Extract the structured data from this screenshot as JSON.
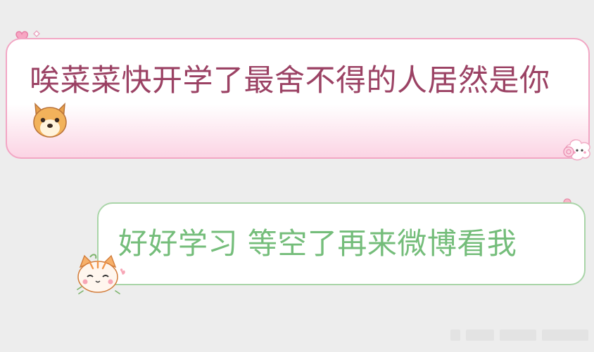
{
  "timestamp": "",
  "messages": [
    {
      "side": "left",
      "text": "唉菜菜快开学了最舍不得的人居然是你",
      "emoji": "dog-face-icon"
    },
    {
      "side": "right",
      "text": "好好学习 等空了再来微博看我"
    }
  ],
  "colors": {
    "left_border": "#f2a6c4",
    "left_text": "#9b4264",
    "right_border": "#a9d5a8",
    "right_text": "#74bd7a",
    "background": "#ededed"
  }
}
